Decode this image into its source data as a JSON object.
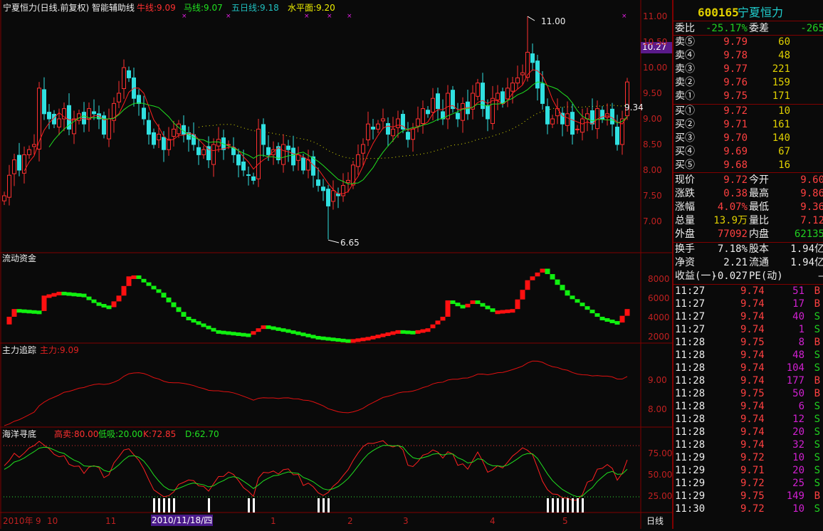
{
  "header": {
    "title": "宁夏恒力(日线.前复权) 智能辅助线",
    "niu": "牛线:9.09",
    "ma": "马线:9.07",
    "wuri": "五日线:9.18",
    "shuiping": "水平面:9.20"
  },
  "main_chart": {
    "price_ticks": [
      "11.00",
      "10.50",
      "10.00",
      "9.50",
      "9.00",
      "8.50",
      "8.00",
      "7.50",
      "7.00"
    ],
    "current_tag": "10.27",
    "high_label": "11.00",
    "low_label": "6.65",
    "last_label": "9.34"
  },
  "flow_panel": {
    "title": "流动资金",
    "ticks": [
      "8000",
      "6000",
      "4000",
      "2000"
    ]
  },
  "zhuli_panel": {
    "title": "主力追踪",
    "value": "主力:9.09",
    "ticks": [
      "9.00",
      "8.00"
    ]
  },
  "kdj_panel": {
    "title": "海洋寻底",
    "gaomai": "高卖:80.00",
    "dixi": "低吸:20.00",
    "k": "K:72.85",
    "d": "D:62.70",
    "ticks": [
      "75.00",
      "50.00",
      "25.00"
    ]
  },
  "date_axis": {
    "labels": [
      "2010年",
      "9",
      "10",
      "11",
      "1",
      "2",
      "3",
      "4",
      "5"
    ],
    "cursor_date": "2010/11/18/四",
    "period": "日线"
  },
  "chart_data": {
    "type": "candlestick",
    "closes": [
      7.5,
      7.9,
      8.2,
      8.0,
      8.3,
      8.4,
      8.5,
      9.6,
      9.1,
      9.0,
      8.9,
      9.0,
      9.2,
      8.8,
      9.0,
      9.1,
      8.9,
      9.2,
      9.1,
      9.0,
      8.7,
      9.0,
      9.3,
      9.5,
      10.0,
      9.8,
      9.4,
      9.3,
      9.0,
      8.7,
      8.5,
      8.7,
      8.4,
      8.6,
      8.8,
      8.9,
      8.7,
      8.6,
      8.5,
      8.3,
      8.4,
      8.2,
      8.5,
      8.6,
      8.4,
      8.5,
      8.3,
      8.1,
      8.0,
      7.9,
      7.8,
      8.8,
      8.5,
      8.3,
      8.4,
      8.2,
      8.5,
      8.4,
      8.1,
      8.3,
      8.0,
      8.2,
      7.9,
      7.7,
      7.6,
      7.3,
      7.6,
      7.5,
      7.7,
      7.8,
      8.1,
      8.3,
      8.5,
      8.9,
      8.8,
      8.9,
      9.0,
      8.7,
      8.8,
      9.0,
      8.8,
      8.6,
      8.8,
      9.0,
      9.2,
      9.1,
      9.4,
      9.2,
      9.0,
      9.5,
      9.2,
      9.0,
      9.3,
      9.1,
      9.5,
      9.7,
      9.2,
      9.0,
      9.4,
      9.5,
      9.3,
      9.6,
      9.7,
      9.8,
      9.9,
      10.3,
      10.1,
      9.6,
      9.3,
      8.9,
      9.0,
      9.2,
      8.9,
      9.1,
      8.7,
      8.8,
      9.0,
      9.1,
      8.9,
      9.2,
      9.0,
      9.1,
      8.9,
      8.5,
      9.0,
      9.72
    ],
    "ylim": [
      6.5,
      11.1
    ],
    "flow_anchors": [
      [
        0,
        3200
      ],
      [
        2,
        4800
      ],
      [
        7,
        4600
      ],
      [
        8,
        6200
      ],
      [
        11,
        6600
      ],
      [
        15,
        6400
      ],
      [
        18,
        5500
      ],
      [
        21,
        5000
      ],
      [
        23,
        6200
      ],
      [
        25,
        8200
      ],
      [
        26,
        8300
      ],
      [
        31,
        6500
      ],
      [
        36,
        4000
      ],
      [
        42,
        2600
      ],
      [
        49,
        2200
      ],
      [
        52,
        3100
      ],
      [
        56,
        2700
      ],
      [
        62,
        2000
      ],
      [
        69,
        1600
      ],
      [
        73,
        1900
      ],
      [
        79,
        2600
      ],
      [
        82,
        2500
      ],
      [
        85,
        2800
      ],
      [
        88,
        4000
      ],
      [
        89,
        5700
      ],
      [
        92,
        5000
      ],
      [
        94,
        5700
      ],
      [
        98,
        4600
      ],
      [
        102,
        4800
      ],
      [
        105,
        7800
      ],
      [
        108,
        9000
      ],
      [
        113,
        6200
      ],
      [
        119,
        4000
      ],
      [
        123,
        3400
      ],
      [
        125,
        4800
      ]
    ]
  },
  "quote": {
    "code": "600165",
    "name": "宁夏恒力",
    "weibi_label": "委比",
    "weibi": "-25.17%",
    "weicha_label": "委差",
    "weicha": "-265",
    "asks": [
      [
        "卖⑤",
        "9.79",
        "60"
      ],
      [
        "卖④",
        "9.78",
        "48"
      ],
      [
        "卖③",
        "9.77",
        "221"
      ],
      [
        "卖②",
        "9.76",
        "159"
      ],
      [
        "卖①",
        "9.75",
        "171"
      ]
    ],
    "bids": [
      [
        "买①",
        "9.72",
        "10"
      ],
      [
        "买②",
        "9.71",
        "161"
      ],
      [
        "买③",
        "9.70",
        "140"
      ],
      [
        "买④",
        "9.69",
        "67"
      ],
      [
        "买⑤",
        "9.68",
        "16"
      ]
    ],
    "stats": [
      [
        "现价",
        "9.72",
        "今开",
        "9.60"
      ],
      [
        "涨跌",
        "0.38",
        "最高",
        "9.86"
      ],
      [
        "涨幅",
        "4.07%",
        "最低",
        "9.36"
      ],
      [
        "总量",
        "13.9万",
        "量比",
        "7.12"
      ],
      [
        "外盘",
        "77092",
        "内盘",
        "62135"
      ]
    ],
    "info": [
      [
        "换手",
        "7.18%",
        "股本",
        "1.94亿"
      ],
      [
        "净资",
        "2.21",
        "流通",
        "1.94亿"
      ],
      [
        "收益(一)",
        "-0.027",
        "PE(动)",
        "—"
      ]
    ]
  },
  "trades": [
    [
      "11:27",
      "9.74",
      "51",
      "B"
    ],
    [
      "11:27",
      "9.74",
      "17",
      "B"
    ],
    [
      "11:27",
      "9.74",
      "40",
      "S"
    ],
    [
      "11:27",
      "9.74",
      "1",
      "S"
    ],
    [
      "11:28",
      "9.75",
      "8",
      "B"
    ],
    [
      "11:28",
      "9.74",
      "48",
      "S"
    ],
    [
      "11:28",
      "9.74",
      "104",
      "S"
    ],
    [
      "11:28",
      "9.74",
      "177",
      "B"
    ],
    [
      "11:28",
      "9.75",
      "50",
      "B"
    ],
    [
      "11:28",
      "9.74",
      "6",
      "S"
    ],
    [
      "11:28",
      "9.74",
      "12",
      "S"
    ],
    [
      "11:28",
      "9.74",
      "20",
      "S"
    ],
    [
      "11:28",
      "9.74",
      "32",
      "S"
    ],
    [
      "11:29",
      "9.72",
      "10",
      "S"
    ],
    [
      "11:29",
      "9.71",
      "20",
      "S"
    ],
    [
      "11:29",
      "9.72",
      "25",
      "S"
    ],
    [
      "11:29",
      "9.75",
      "149",
      "B"
    ],
    [
      "11:30",
      "9.72",
      "10",
      "S"
    ]
  ]
}
